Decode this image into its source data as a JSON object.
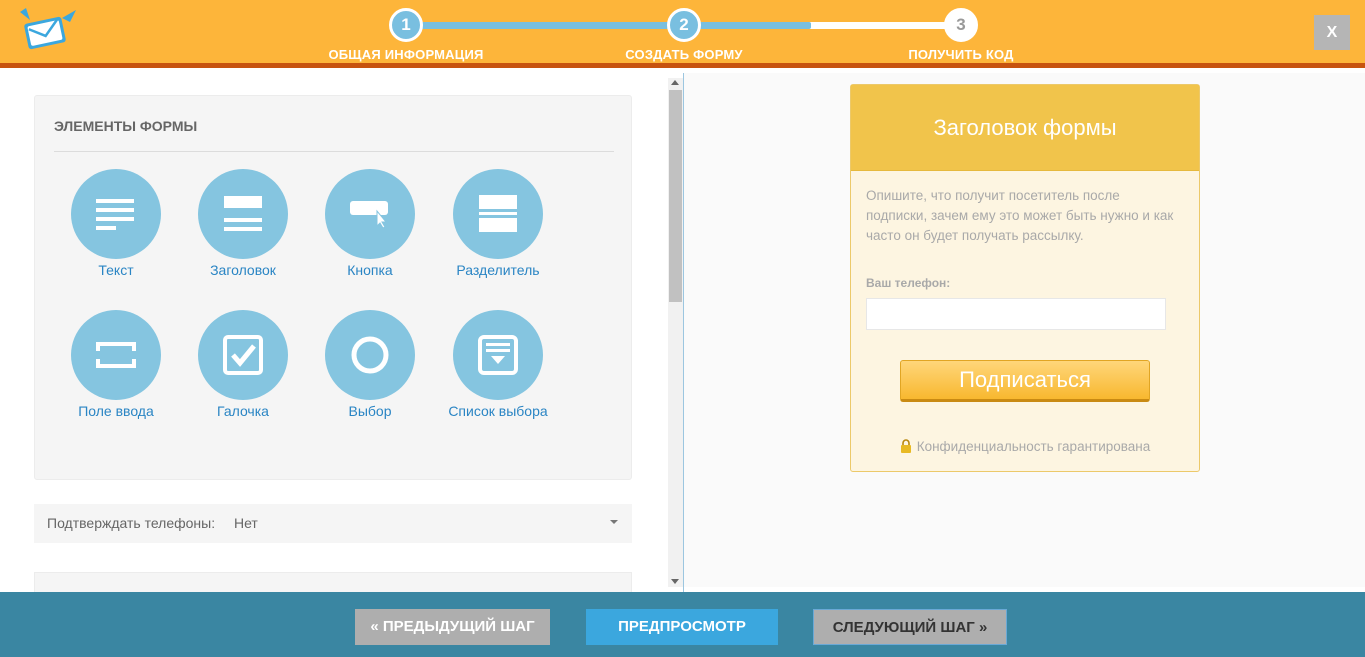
{
  "header": {
    "steps": [
      {
        "number": "1",
        "label": "ОБЩАЯ ИНФОРМАЦИЯ",
        "state": "done"
      },
      {
        "number": "2",
        "label": "СОЗДАТЬ ФОРМУ",
        "state": "active"
      },
      {
        "number": "3",
        "label": "ПОЛУЧИТЬ КОД",
        "state": "inactive"
      }
    ],
    "progress_percent": 73,
    "close_label": "X"
  },
  "left": {
    "elements_title": "ЭЛЕМЕНТЫ ФОРМЫ",
    "elements": [
      {
        "label": "Текст",
        "icon": "text-lines-icon"
      },
      {
        "label": "Заголовок",
        "icon": "heading-icon"
      },
      {
        "label": "Кнопка",
        "icon": "button-cursor-icon"
      },
      {
        "label": "Разделитель",
        "icon": "divider-icon"
      },
      {
        "label": "Поле ввода",
        "icon": "input-field-icon"
      },
      {
        "label": "Галочка",
        "icon": "checkbox-icon"
      },
      {
        "label": "Выбор",
        "icon": "radio-icon"
      },
      {
        "label": "Список выбора",
        "icon": "select-list-icon"
      }
    ],
    "confirm_phones": {
      "label": "Подтверждать телефоны:",
      "value": "Нет"
    }
  },
  "preview": {
    "form_title": "Заголовок формы",
    "description": "Опишите, что получит посетитель после подписки, зачем ему это может быть нужно и как часто он будет получать рассылку.",
    "phone_label": "Ваш телефон:",
    "phone_value": "",
    "subscribe_label": "Подписаться",
    "privacy_text": "Конфиденциальность гарантирована"
  },
  "footer": {
    "prev_label": "« ПРЕДЫДУЩИЙ ШАГ",
    "preview_label": "ПРЕДПРОСМОТР",
    "next_label": "СЛЕДУЮЩИЙ ШАГ »"
  },
  "colors": {
    "header_bg": "#fdb53a",
    "header_border": "#c7530f",
    "accent_blue": "#79bfe0",
    "icon_circle": "#85c5e0",
    "label_blue": "#2a85c4",
    "form_head": "#f1c44b",
    "footer_bg": "#3a86a2"
  }
}
